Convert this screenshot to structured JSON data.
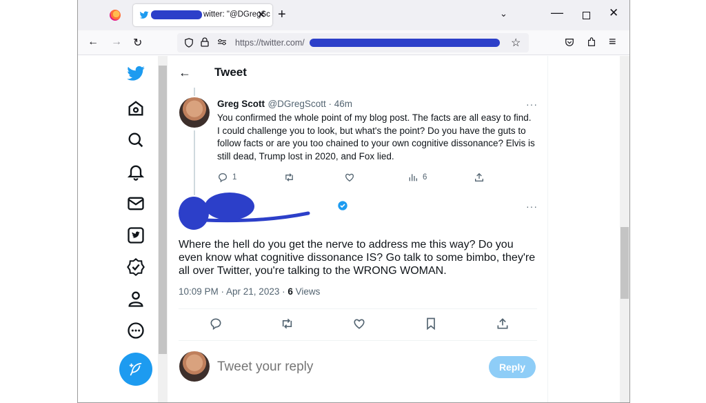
{
  "browser": {
    "tab_title": "witter: \"@DGregSc",
    "url_prefix": "https://twitter.com/",
    "tab_close": "✕",
    "new_tab": "+",
    "tab_list": "⌄",
    "minimize": "—",
    "close": "✕"
  },
  "nav": {
    "back": "←",
    "forward": "→",
    "reload": "↻",
    "star": "☆",
    "menu": "≡"
  },
  "header": {
    "back": "←",
    "title": "Tweet"
  },
  "parent_tweet": {
    "name": "Greg Scott",
    "handle": "@DGregScott · 46m",
    "text": "You confirmed the whole point of my blog post. The facts are all easy to find. I could challenge you to look, but what's the point? Do you have the guts to follow facts or are you too chained to your own cognitive dissonance? Elvis is still dead, Trump lost in 2020, and Fox lied.",
    "reply_count": "1",
    "view_count": "6",
    "more": "···"
  },
  "main_tweet": {
    "text": "Where the hell do you get the nerve to address me this way?  Do you even know what cognitive dissonance IS? Go talk to some bimbo, they're all over Twitter, you're talking to the WRONG WOMAN.",
    "timestamp": "10:09 PM · Apr 21, 2023 · ",
    "views_count": "6",
    "views_label": " Views",
    "more": "···"
  },
  "reply_box": {
    "placeholder": "Tweet your reply",
    "button": "Reply"
  },
  "colors": {
    "accent": "#1d9bf0",
    "redaction": "#2c3fc9"
  }
}
